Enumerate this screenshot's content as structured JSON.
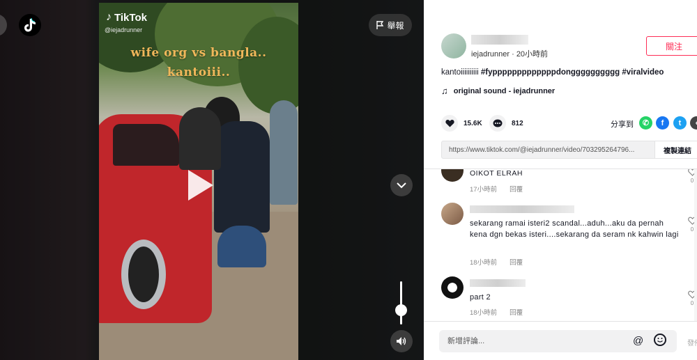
{
  "video": {
    "report_label": "舉報",
    "watermark": "TikTok",
    "watermark_handle": "@iejadrunner",
    "overlay_line1": "wife org vs bangla..",
    "overlay_line2": "kantoiii.."
  },
  "author": {
    "meta": "iejadrunner · 20小時前",
    "follow_label": "關注"
  },
  "post": {
    "caption_text": "kantoiiiiiiiiii ",
    "hashtag1": "#fypppppppppppppdongggggggggg",
    "hashtag2": "#viralvideo",
    "sound": "original sound - iejadrunner"
  },
  "stats": {
    "likes": "15.6K",
    "comments": "812",
    "share_label": "分享到"
  },
  "link": {
    "url": "https://www.tiktok.com/@iejadrunner/video/703295264796...",
    "copy_label": "複製連結"
  },
  "comments": [
    {
      "name": "OIKOT ELRAH",
      "text": "",
      "time": "17小時前",
      "reply": "回覆",
      "likes": "0"
    },
    {
      "name": "",
      "text": "sekarang ramai isteri2 scandal...aduh...aku da pernah kena dgn bekas isteri....sekarang da seram nk kahwin lagi",
      "time": "18小時前",
      "reply": "回覆",
      "likes": "0"
    },
    {
      "name": "",
      "text": "part 2",
      "time": "18小時前",
      "reply": "回覆",
      "likes": "0"
    }
  ],
  "composer": {
    "placeholder": "新增評論...",
    "post_label": "發佈"
  },
  "colors": {
    "accent": "#fe2c55",
    "whatsapp": "#25d366",
    "facebook": "#1877f2",
    "twitter": "#1da1f2"
  },
  "icons": [
    "tiktok-logo-icon",
    "flag-icon",
    "play-icon",
    "chevron-down-icon",
    "volume-icon",
    "heart-icon",
    "comment-icon",
    "music-note-icon",
    "whatsapp-icon",
    "facebook-icon",
    "twitter-icon",
    "more-share-icon",
    "at-icon",
    "emoji-icon"
  ]
}
